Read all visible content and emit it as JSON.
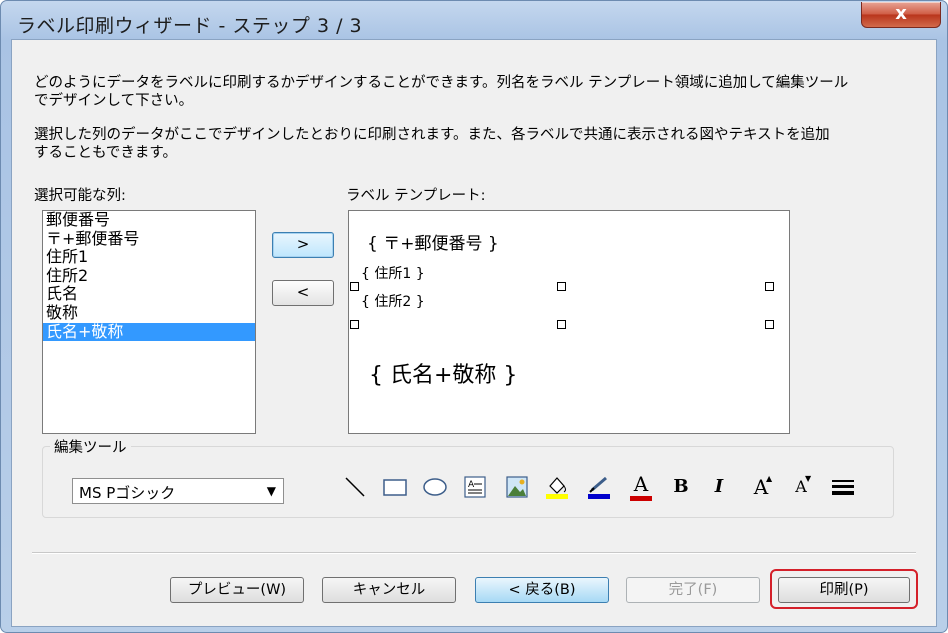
{
  "window": {
    "title": "ラベル印刷ウィザード - ステップ 3 / 3",
    "close_label": "x"
  },
  "description": {
    "line1": "どのようにデータをラベルに印刷するかデザインすることができます。列名をラベル テンプレート領域に追加して編集ツール",
    "line2": "でデザインして下さい。",
    "line3": "選択した列のデータがここでデザインしたとおりに印刷されます。また、各ラベルで共通に表示される図やテキストを追加",
    "line4": "することもできます。"
  },
  "columns": {
    "label": "選択可能な列:",
    "items": [
      "郵便番号",
      "〒+郵便番号",
      "住所1",
      "住所2",
      "氏名",
      "敬称",
      "氏名+敬称"
    ],
    "selected_index": 6
  },
  "move_buttons": {
    "add": ">",
    "remove": "<"
  },
  "template": {
    "label": "ラベル テンプレート:",
    "fields": [
      "{ 〒+郵便番号 }",
      "{ 住所1 }",
      "{ 住所2 }",
      "{ 氏名+敬称 }"
    ]
  },
  "tools": {
    "group_label": "編集ツール",
    "font_value": "MS Pゴシック",
    "icons": [
      "line-icon",
      "rectangle-icon",
      "ellipse-icon",
      "textbox-icon",
      "image-icon",
      "fill-color-icon",
      "line-color-icon",
      "font-color-icon",
      "bold-icon",
      "italic-icon",
      "font-larger-icon",
      "font-smaller-icon",
      "line-width-icon"
    ],
    "bold_glyph": "B",
    "italic_glyph": "I",
    "font_color_glyph": "A",
    "grow_glyph": "A",
    "shrink_glyph": "A"
  },
  "buttons": {
    "preview": "プレビュー(W)",
    "cancel": "キャンセル",
    "back": "< 戻る(B)",
    "finish": "完了(F)",
    "print": "印刷(P)"
  },
  "colors": {
    "selection": "#3399ff",
    "highlight": "#d4202a",
    "fill_swatch": "#ffff00",
    "line_swatch": "#0000cc",
    "font_swatch": "#cc0000"
  }
}
